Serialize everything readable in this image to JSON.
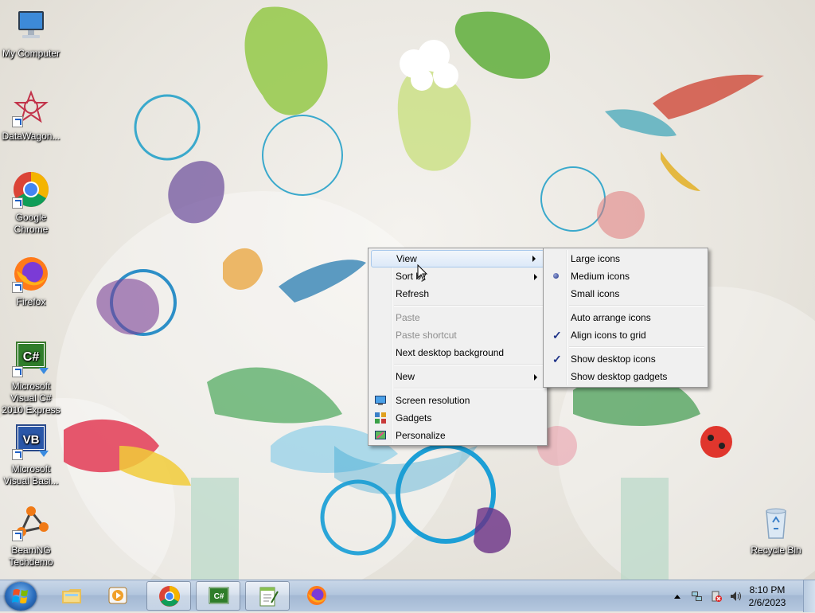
{
  "desktop_icons": [
    {
      "id": "my-computer",
      "label": "My Computer"
    },
    {
      "id": "datawagon",
      "label": "DataWagon..."
    },
    {
      "id": "chrome",
      "label": "Google Chrome"
    },
    {
      "id": "firefox",
      "label": "Firefox"
    },
    {
      "id": "visual-csharp",
      "label": "Microsoft Visual C# 2010 Express"
    },
    {
      "id": "visual-basic",
      "label": "Microsoft Visual Basi..."
    },
    {
      "id": "beamng",
      "label": "BeamNG Techdemo"
    },
    {
      "id": "recycle-bin",
      "label": "Recycle Bin"
    }
  ],
  "context_menu": {
    "view": "View",
    "sort_by": "Sort by",
    "refresh": "Refresh",
    "paste": "Paste",
    "paste_shortcut": "Paste shortcut",
    "next_background": "Next desktop background",
    "new": "New",
    "screen_resolution": "Screen resolution",
    "gadgets": "Gadgets",
    "personalize": "Personalize"
  },
  "view_submenu": {
    "large_icons": "Large icons",
    "medium_icons": "Medium icons",
    "small_icons": "Small icons",
    "auto_arrange": "Auto arrange icons",
    "align_grid": "Align icons to grid",
    "show_icons": "Show desktop icons",
    "show_gadgets": "Show desktop gadgets",
    "selected_size": "Medium icons",
    "checked": [
      "Align icons to grid",
      "Show desktop icons"
    ]
  },
  "taskbar": {
    "pinned": [
      "windows-explorer-icon",
      "media-player-icon",
      "chrome-icon",
      "visual-csharp-icon",
      "notepadpp-icon",
      "firefox-icon"
    ],
    "clock_time": "8:10 PM",
    "clock_date": "2/6/2023"
  },
  "colors": {
    "menu_bg": "#f0f0f0",
    "menu_highlight": "#dce9f8",
    "taskbar": "#b3c6de"
  }
}
